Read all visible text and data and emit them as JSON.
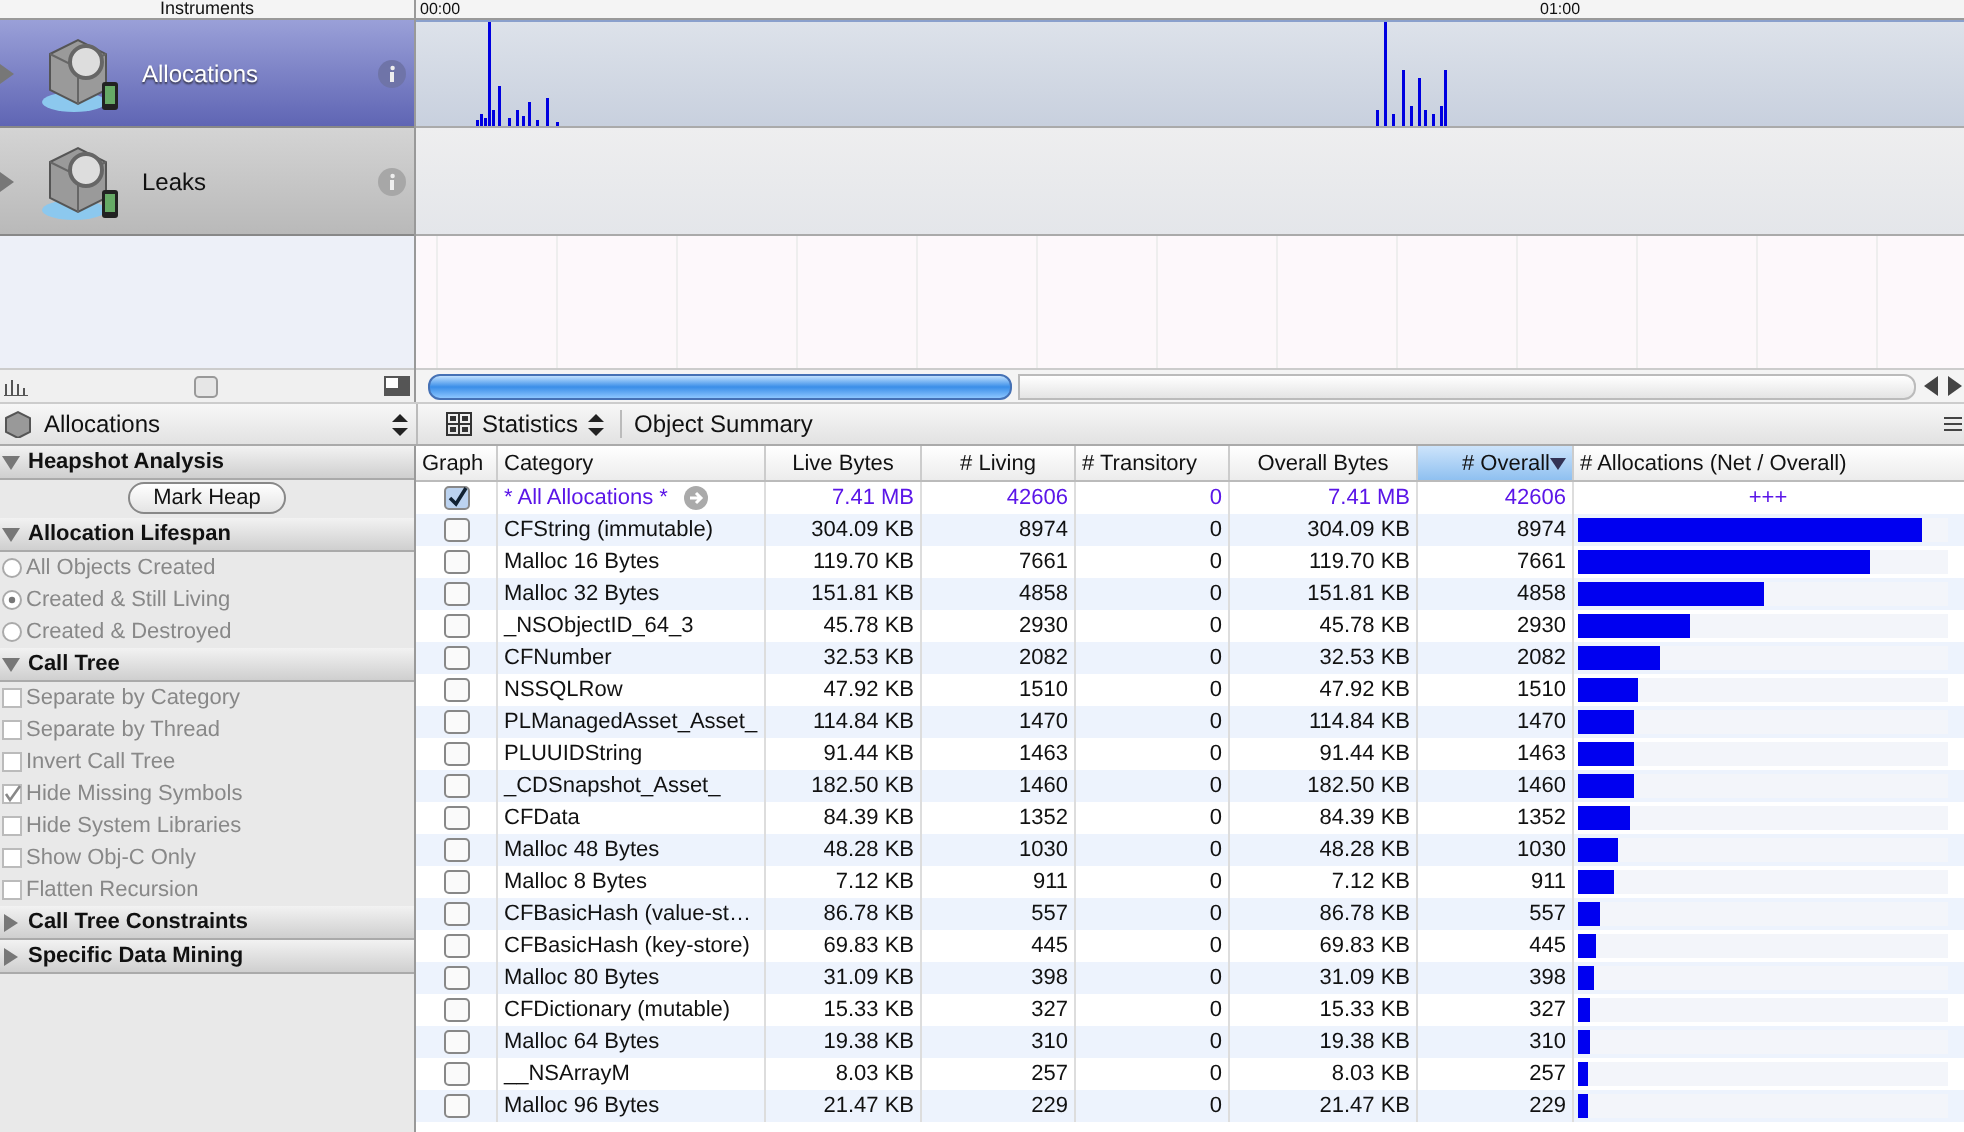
{
  "header": {
    "instruments_label": "Instruments",
    "time_marks": [
      "00:00",
      "01:00"
    ]
  },
  "instruments": [
    {
      "name": "Allocations",
      "selected": true
    },
    {
      "name": "Leaks",
      "selected": false
    }
  ],
  "detail_bar": {
    "instrument": "Allocations",
    "view": "Statistics",
    "breadcrumb": "Object Summary"
  },
  "sidebar": {
    "sections": [
      {
        "title": "Heapshot Analysis",
        "expanded": true,
        "kind": "button",
        "items": [
          {
            "label": "Mark Heap"
          }
        ]
      },
      {
        "title": "Allocation Lifespan",
        "expanded": true,
        "kind": "radio",
        "items": [
          {
            "label": "All Objects Created",
            "selected": false,
            "disabled": true
          },
          {
            "label": "Created & Still Living",
            "selected": true,
            "disabled": true
          },
          {
            "label": "Created & Destroyed",
            "selected": false,
            "disabled": true
          }
        ]
      },
      {
        "title": "Call Tree",
        "expanded": true,
        "kind": "checkbox",
        "items": [
          {
            "label": "Separate by Category",
            "checked": false,
            "disabled": true
          },
          {
            "label": "Separate by Thread",
            "checked": false,
            "disabled": true
          },
          {
            "label": "Invert Call Tree",
            "checked": false,
            "disabled": true
          },
          {
            "label": "Hide Missing Symbols",
            "checked": true,
            "disabled": true
          },
          {
            "label": "Hide System Libraries",
            "checked": false,
            "disabled": true
          },
          {
            "label": "Show Obj-C Only",
            "checked": false,
            "disabled": true
          },
          {
            "label": "Flatten Recursion",
            "checked": false,
            "disabled": true
          }
        ]
      },
      {
        "title": "Call Tree Constraints",
        "expanded": false
      },
      {
        "title": "Specific Data Mining",
        "expanded": false
      }
    ]
  },
  "table": {
    "columns": [
      {
        "label": "Graph",
        "sorted": false
      },
      {
        "label": "Category",
        "sorted": false
      },
      {
        "label": "Live Bytes",
        "sorted": false
      },
      {
        "label": "# Living",
        "sorted": false
      },
      {
        "label": "# Transitory",
        "sorted": false
      },
      {
        "label": "Overall Bytes",
        "sorted": false
      },
      {
        "label": "# Overall",
        "sorted": true
      },
      {
        "label": "# Allocations (Net / Overall)",
        "sorted": false
      }
    ],
    "rows": [
      {
        "kind": "summary",
        "graph": true,
        "category": "* All Allocations *",
        "live_bytes": "7.41 MB",
        "living": "42606",
        "transitory": "0",
        "overall_bytes": "7.41 MB",
        "overall": "42606",
        "bar_label": "+++"
      },
      {
        "kind": "item",
        "graph": false,
        "category": "CFString (immutable)",
        "live_bytes": "304.09 KB",
        "living": "8974",
        "transitory": "0",
        "overall_bytes": "304.09 KB",
        "overall": "8974",
        "level": 0.93
      },
      {
        "kind": "item",
        "graph": false,
        "category": "Malloc 16 Bytes",
        "live_bytes": "119.70 KB",
        "living": "7661",
        "transitory": "0",
        "overall_bytes": "119.70 KB",
        "overall": "7661",
        "level": 0.79
      },
      {
        "kind": "item",
        "graph": false,
        "category": "Malloc 32 Bytes",
        "live_bytes": "151.81 KB",
        "living": "4858",
        "transitory": "0",
        "overall_bytes": "151.81 KB",
        "overall": "4858",
        "level": 0.5
      },
      {
        "kind": "item",
        "graph": false,
        "category": "_NSObjectID_64_3",
        "live_bytes": "45.78 KB",
        "living": "2930",
        "transitory": "0",
        "overall_bytes": "45.78 KB",
        "overall": "2930",
        "level": 0.3
      },
      {
        "kind": "item",
        "graph": false,
        "category": "CFNumber",
        "live_bytes": "32.53 KB",
        "living": "2082",
        "transitory": "0",
        "overall_bytes": "32.53 KB",
        "overall": "2082",
        "level": 0.22
      },
      {
        "kind": "item",
        "graph": false,
        "category": "NSSQLRow",
        "live_bytes": "47.92 KB",
        "living": "1510",
        "transitory": "0",
        "overall_bytes": "47.92 KB",
        "overall": "1510",
        "level": 0.16
      },
      {
        "kind": "item",
        "graph": false,
        "category": "PLManagedAsset_Asset_",
        "live_bytes": "114.84 KB",
        "living": "1470",
        "transitory": "0",
        "overall_bytes": "114.84 KB",
        "overall": "1470",
        "level": 0.15
      },
      {
        "kind": "item",
        "graph": false,
        "category": "PLUUIDString",
        "live_bytes": "91.44 KB",
        "living": "1463",
        "transitory": "0",
        "overall_bytes": "91.44 KB",
        "overall": "1463",
        "level": 0.15
      },
      {
        "kind": "item",
        "graph": false,
        "category": "_CDSnapshot_Asset_",
        "live_bytes": "182.50 KB",
        "living": "1460",
        "transitory": "0",
        "overall_bytes": "182.50 KB",
        "overall": "1460",
        "level": 0.15
      },
      {
        "kind": "item",
        "graph": false,
        "category": "CFData",
        "live_bytes": "84.39 KB",
        "living": "1352",
        "transitory": "0",
        "overall_bytes": "84.39 KB",
        "overall": "1352",
        "level": 0.14
      },
      {
        "kind": "item",
        "graph": false,
        "category": "Malloc 48 Bytes",
        "live_bytes": "48.28 KB",
        "living": "1030",
        "transitory": "0",
        "overall_bytes": "48.28 KB",
        "overall": "1030",
        "level": 0.11
      },
      {
        "kind": "item",
        "graph": false,
        "category": "Malloc 8 Bytes",
        "live_bytes": "7.12 KB",
        "living": "911",
        "transitory": "0",
        "overall_bytes": "7.12 KB",
        "overall": "911",
        "level": 0.095
      },
      {
        "kind": "item",
        "graph": false,
        "category": "CFBasicHash (value-st…",
        "live_bytes": "86.78 KB",
        "living": "557",
        "transitory": "0",
        "overall_bytes": "86.78 KB",
        "overall": "557",
        "level": 0.06
      },
      {
        "kind": "item",
        "graph": false,
        "category": "CFBasicHash (key-store)",
        "live_bytes": "69.83 KB",
        "living": "445",
        "transitory": "0",
        "overall_bytes": "69.83 KB",
        "overall": "445",
        "level": 0.05
      },
      {
        "kind": "item",
        "graph": false,
        "category": "Malloc 80 Bytes",
        "live_bytes": "31.09 KB",
        "living": "398",
        "transitory": "0",
        "overall_bytes": "31.09 KB",
        "overall": "398",
        "level": 0.045
      },
      {
        "kind": "item",
        "graph": false,
        "category": "CFDictionary (mutable)",
        "live_bytes": "15.33 KB",
        "living": "327",
        "transitory": "0",
        "overall_bytes": "15.33 KB",
        "overall": "327",
        "level": 0.035
      },
      {
        "kind": "item",
        "graph": false,
        "category": "Malloc 64 Bytes",
        "live_bytes": "19.38 KB",
        "living": "310",
        "transitory": "0",
        "overall_bytes": "19.38 KB",
        "overall": "310",
        "level": 0.033
      },
      {
        "kind": "item",
        "graph": false,
        "category": "__NSArrayM",
        "live_bytes": "8.03 KB",
        "living": "257",
        "transitory": "0",
        "overall_bytes": "8.03 KB",
        "overall": "257",
        "level": 0.028
      },
      {
        "kind": "item",
        "graph": false,
        "category": "Malloc 96 Bytes",
        "live_bytes": "21.47 KB",
        "living": "229",
        "transitory": "0",
        "overall_bytes": "21.47 KB",
        "overall": "229",
        "level": 0.025
      }
    ]
  }
}
